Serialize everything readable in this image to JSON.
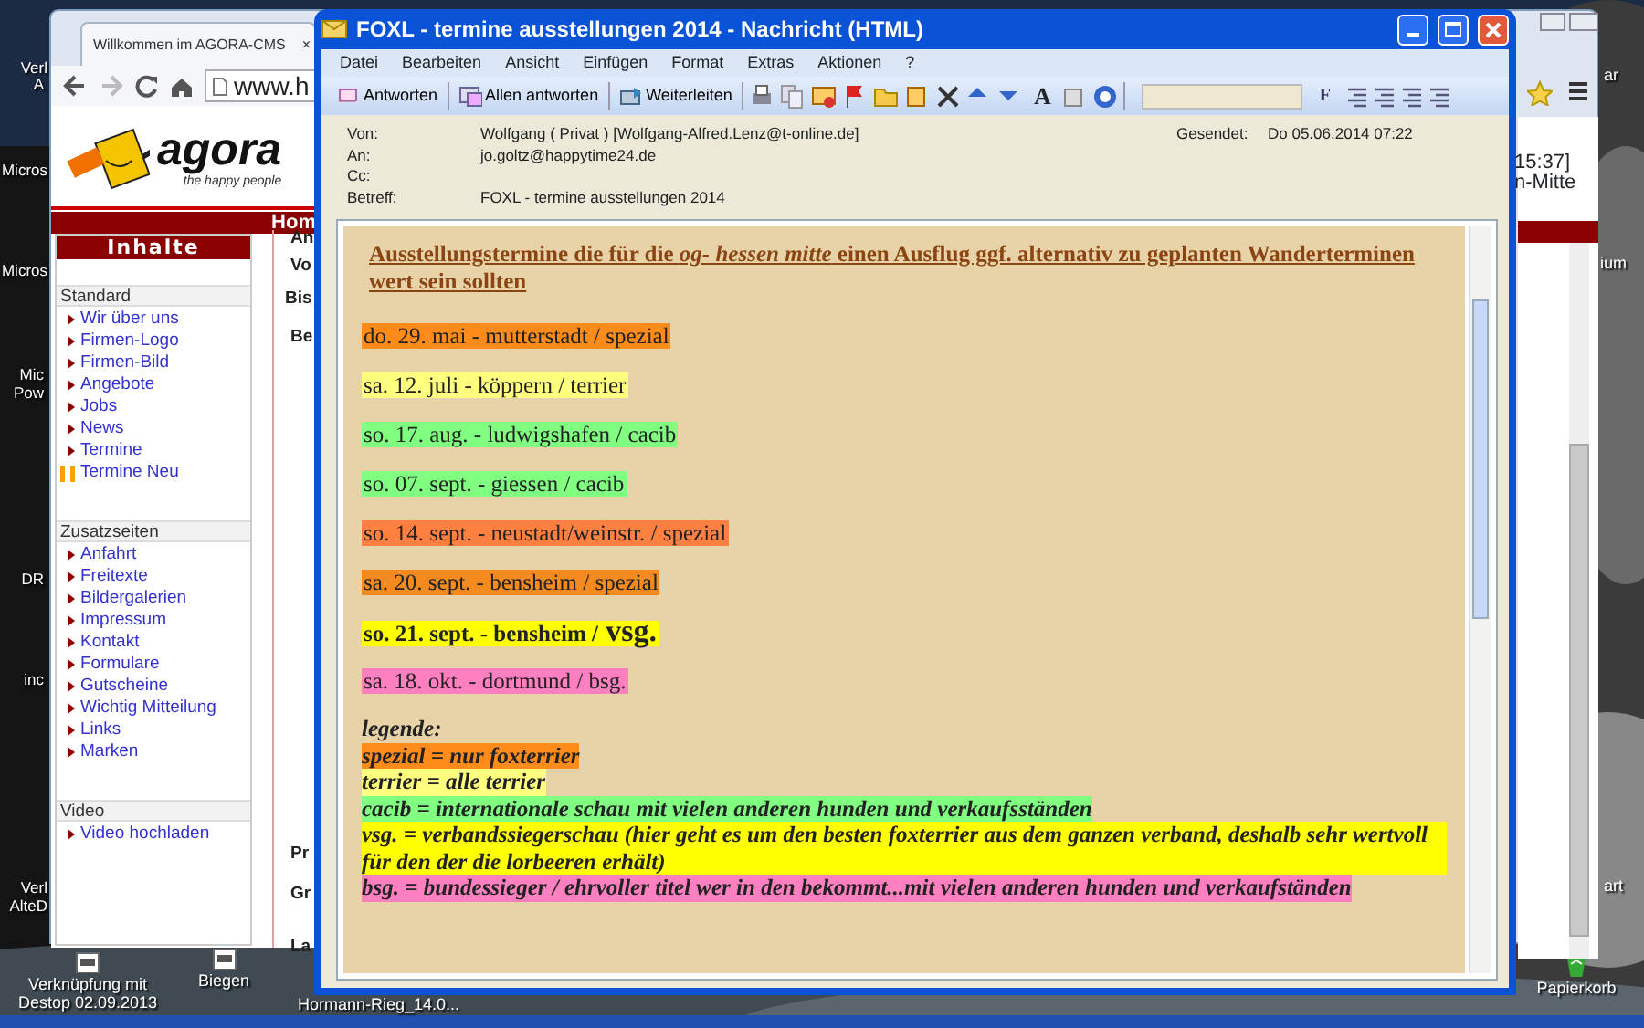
{
  "desktop": {
    "left_labels": [
      "Verl",
      "A",
      "Micros",
      "Micros",
      "Mic",
      "Pow",
      "DR",
      "inc",
      "Verl",
      "AlteD"
    ],
    "right_labels": [
      "ar",
      "ium",
      "art"
    ],
    "icons": [
      {
        "label": "Verknüpfung mit Destop 02.09.2013"
      },
      {
        "label": "Biegen"
      },
      {
        "label": "Hormann-Rieg_14.0..."
      },
      {
        "label": "Papierkorb"
      }
    ]
  },
  "browser": {
    "tab": {
      "title": "Willkommen im AGORA-CMS",
      "close": "×"
    },
    "url": "www.h",
    "logo": {
      "name": "agora",
      "tagline": "the happy people"
    },
    "banner": "Hom",
    "right_texts": [
      "15:37]",
      "n-Mitte"
    ],
    "sidebar": {
      "header": "Inhalte",
      "sections": [
        {
          "title": "Standard",
          "items": [
            {
              "label": "Wir über uns",
              "kind": "link"
            },
            {
              "label": "Firmen-Logo",
              "kind": "link"
            },
            {
              "label": "Firmen-Bild",
              "kind": "link"
            },
            {
              "label": "Angebote",
              "kind": "link"
            },
            {
              "label": "Jobs",
              "kind": "link"
            },
            {
              "label": "News",
              "kind": "link"
            },
            {
              "label": "Termine",
              "kind": "link"
            },
            {
              "label": "Termine Neu",
              "kind": "new"
            }
          ]
        },
        {
          "title": "Zusatzseiten",
          "items": [
            {
              "label": "Anfahrt",
              "kind": "link"
            },
            {
              "label": "Freitexte",
              "kind": "link"
            },
            {
              "label": "Bildergalerien",
              "kind": "link"
            },
            {
              "label": "Impressum",
              "kind": "link"
            },
            {
              "label": "Kontakt",
              "kind": "link"
            },
            {
              "label": "Formulare",
              "kind": "link"
            },
            {
              "label": "Gutscheine",
              "kind": "link"
            },
            {
              "label": "Wichtig Mitteilung",
              "kind": "link"
            },
            {
              "label": "Links",
              "kind": "link"
            },
            {
              "label": "Marken",
              "kind": "link"
            }
          ]
        },
        {
          "title": "Video",
          "items": [
            {
              "label": "Video hochladen",
              "kind": "link"
            }
          ]
        }
      ]
    },
    "middle_labels": [
      "An",
      "Vo",
      "Bis",
      "Be",
      "Pr",
      "Gr",
      "La"
    ]
  },
  "email": {
    "title": "FOXL - termine ausstellungen 2014  - Nachricht (HTML)",
    "menu": [
      "Datei",
      "Bearbeiten",
      "Ansicht",
      "Einfügen",
      "Format",
      "Extras",
      "Aktionen",
      "?"
    ],
    "toolbar": {
      "buttons": [
        "Antworten",
        "Allen antworten",
        "Weiterleiten"
      ],
      "font_glyph": "A",
      "bold_glyph": "F"
    },
    "header": [
      {
        "label": "Von:",
        "value": "Wolfgang ( Privat ) [Wolfgang-Alfred.Lenz@t-online.de]"
      },
      {
        "label": "An:",
        "value": "jo.goltz@happytime24.de"
      },
      {
        "label": "Cc:"
      },
      {
        "label": "Betreff:",
        "value": "FOXL - termine ausstellungen 2014"
      }
    ],
    "sent": {
      "label": "Gesendet:",
      "value": "Do 05.06.2014 07:22"
    },
    "heading": "Ausstellungstermine die für die *og- hessen  mitte* einen Ausflug ggf. alternativ zu geplanten Wanderterminen wert sein sollten",
    "entries": [
      {
        "text": "do. 29. mai  - mutterstadt / spezial",
        "color": "#ff8c1a",
        "bold": false
      },
      {
        "text": "sa. 12. juli   - köppern / terrier",
        "color": "#ffff80",
        "bold": false
      },
      {
        "text": "so. 17. aug. - ludwigshafen / cacib",
        "color": "#80ff80",
        "bold": false
      },
      {
        "text": "so. 07. sept. - giessen / cacib",
        "color": "#80ff80",
        "bold": false
      },
      {
        "text": "so. 14. sept. - neustadt/weinstr. / spezial",
        "color": "#ff8040",
        "bold": false
      },
      {
        "text": "sa. 20. sept. - bensheim / spezial",
        "color": "#f58a1e",
        "bold": false
      },
      {
        "text": "so. 21. sept. - bensheim / ",
        "big": "vsg.",
        "color": "#ffff00",
        "bold": true
      },
      {
        "text": "sa. 18. okt. - dortmund / bsg.",
        "color": "#ff80c0",
        "bold": false
      }
    ],
    "legend_title": "legende:",
    "legend": [
      {
        "text": "spezial = nur foxterrier",
        "color": "#ff8c1a"
      },
      {
        "text": "terrier  = alle terrier",
        "color": "#ffff80"
      },
      {
        "text": "cacib   = internationale schau mit vielen anderen hunden und verkaufsständen",
        "color": "#80ff80"
      },
      {
        "text": "vsg.     = verbandssiegerschau (hier geht es um den besten foxterrier aus dem ganzen verband, deshalb sehr wertvoll für den der die lorbeeren erhält)",
        "color": "#ffff00"
      },
      {
        "text": "bsg.     = bundessieger  / ehrvoller titel wer in den bekommt...mit vielen anderen hunden und verkaufständen",
        "color": "#ff80c0"
      }
    ]
  }
}
